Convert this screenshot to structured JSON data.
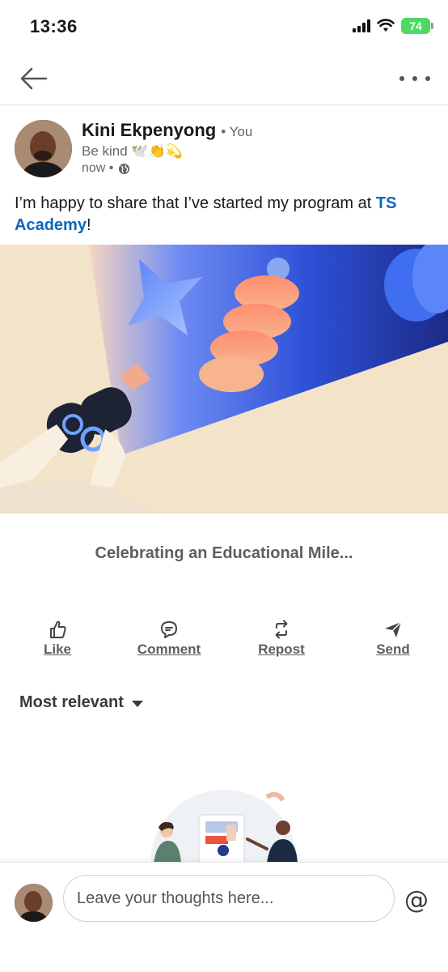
{
  "status_bar": {
    "time": "13:36",
    "battery": "74",
    "icons": [
      "signal-icon",
      "wifi-icon",
      "battery-charging-icon"
    ]
  },
  "nav": {
    "icons": [
      "back-arrow-icon",
      "more-dots-icon"
    ]
  },
  "post": {
    "author": {
      "name": "Kini Ekpenyong",
      "relation": "• You",
      "tagline": "Be kind 🕊️👏💫",
      "time": "now •",
      "visibility_icon": "globe-icon"
    },
    "text_prefix": "I’m happy to share that I’ve started my program at",
    "link_text": "TS Academy",
    "text_suffix": "!",
    "card_title": "Celebrating an Educational Mile..."
  },
  "actions": [
    {
      "label": "Like",
      "icon": "thumbs-up-icon"
    },
    {
      "label": "Comment",
      "icon": "comment-icon"
    },
    {
      "label": "Repost",
      "icon": "repost-icon"
    },
    {
      "label": "Send",
      "icon": "send-icon"
    }
  ],
  "comments": {
    "sort_label": "Most relevant"
  },
  "composer": {
    "placeholder": "Leave your thoughts here...",
    "mention_symbol": "@"
  },
  "colors": {
    "link": "#0a66c2",
    "battery": "#4cd964",
    "muted_text": "#666666"
  }
}
